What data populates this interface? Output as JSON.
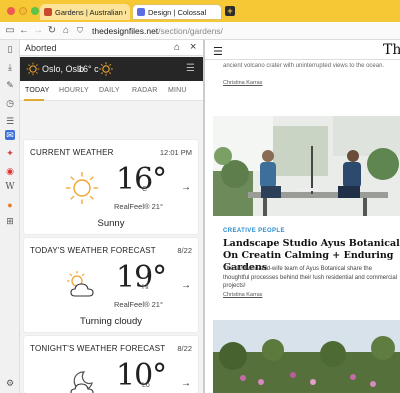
{
  "browser": {
    "tabs": [
      {
        "label": "Gardens | Australian Gard"
      },
      {
        "label": "Design | Colossal"
      }
    ],
    "url_host": "thedesignfiles.net",
    "url_path": "/section/gardens/"
  },
  "panel": {
    "title": "Aborted"
  },
  "weather": {
    "city": "Oslo, Oslo",
    "header_temp": "16° c",
    "tabs": [
      "TODAY",
      "HOURLY",
      "DAILY",
      "RADAR",
      "MINU"
    ],
    "active_tab": "TODAY",
    "cards": [
      {
        "title": "CURRENT WEATHER",
        "time": "12:01 PM",
        "temp": "16°",
        "unit": "C",
        "realfeel": "RealFeel® 21°",
        "condition": "Sunny",
        "icon": "sun-icon"
      },
      {
        "title": "TODAY'S WEATHER FORECAST",
        "time": "8/22",
        "temp": "19°",
        "unit": "Hi",
        "realfeel": "RealFeel® 21°",
        "condition": "Turning cloudy",
        "icon": "partly-cloudy-icon"
      },
      {
        "title": "TONIGHT'S WEATHER FORECAST",
        "time": "8/22",
        "temp": "10°",
        "unit": "Lo",
        "icon": "night-cloudy-icon"
      }
    ]
  },
  "page": {
    "logo": "The",
    "snippet": "ancient volcano crater with uninterrupted views to the ocean.",
    "author1": "Christina Karras",
    "kicker": "CREATIVE PEOPLE",
    "headline": "Landscape Studio Ayus Botanical On Creatin Calming + Enduring Gardens",
    "dek": "The husband-and-wife team of Ayus Botanical share the thoughtful processes behind their lush residential and commercial projects!",
    "author2": "Christina Karras"
  },
  "colors": {
    "titlebar": "#f6c836",
    "accent_tab": "#e0a830",
    "kicker": "#2a8bd0",
    "sun": "#f0a531"
  }
}
